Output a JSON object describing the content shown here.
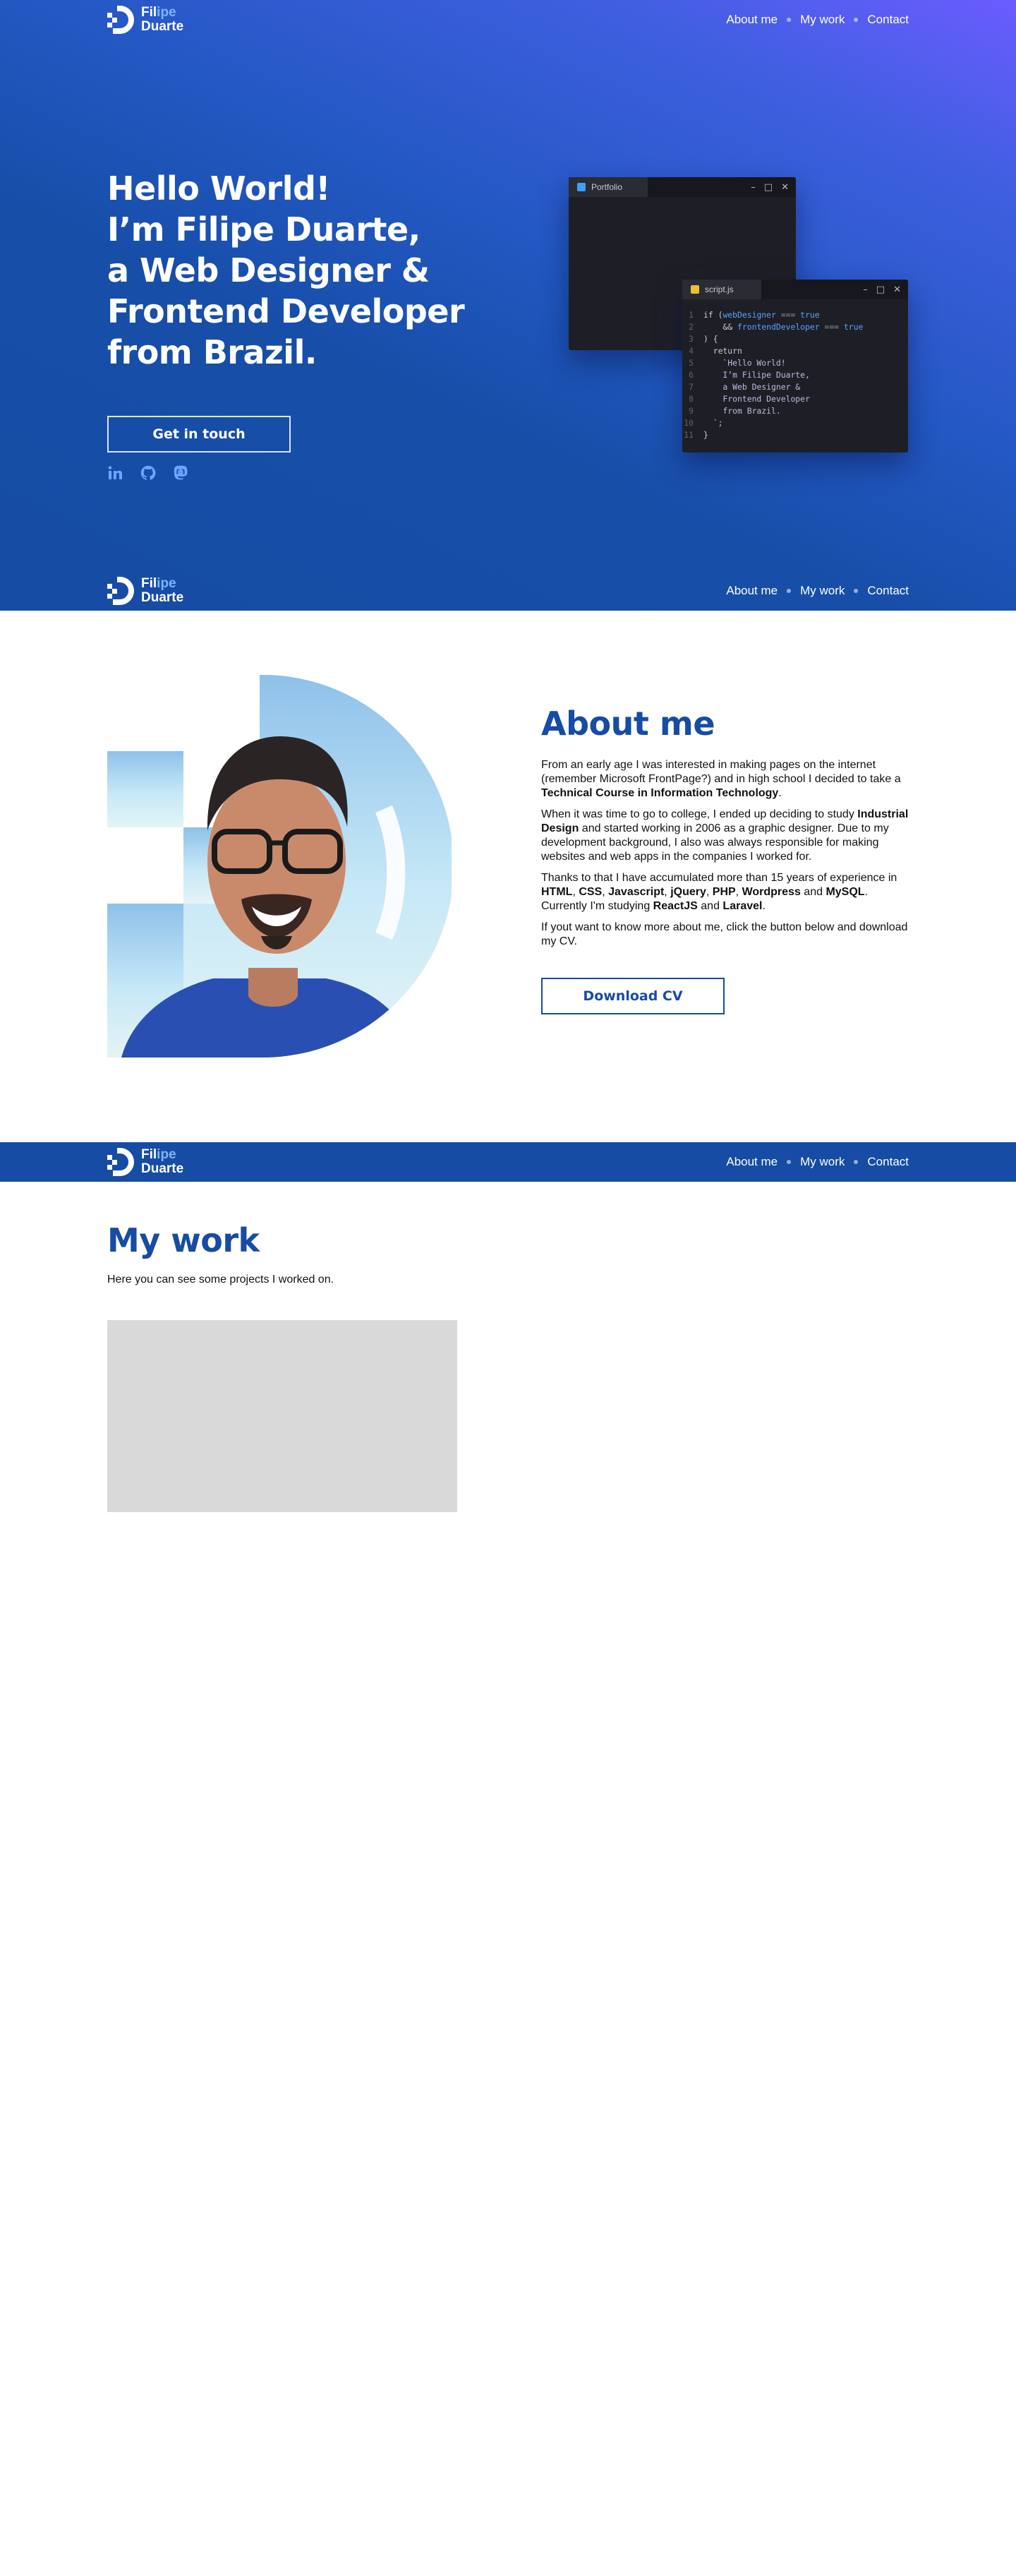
{
  "brand": {
    "first": "Fil",
    "first_highlight": "ipe",
    "last": "Duarte"
  },
  "nav": {
    "links": [
      "About me",
      "My work",
      "Contact"
    ]
  },
  "hero": {
    "lines": [
      "Hello World!",
      "I’m Filipe Duarte,",
      "a Web Designer &",
      "Frontend Developer",
      "from Brazil."
    ],
    "cta": "Get in touch",
    "socials": [
      "linkedin-icon",
      "github-icon",
      "mastodon-icon"
    ]
  },
  "editor": {
    "window_a": {
      "tab": "Portfolio",
      "controls": [
        "–",
        "□",
        "✕"
      ]
    },
    "window_b": {
      "tab": "script.js",
      "controls": [
        "–",
        "□",
        "✕"
      ],
      "code": [
        {
          "n": "1",
          "parts": [
            [
              "kw",
              "if ("
            ],
            [
              "var",
              "webDesigner"
            ],
            [
              "op",
              " === "
            ],
            [
              "var",
              "true"
            ]
          ]
        },
        {
          "n": "2",
          "parts": [
            [
              "kw",
              "    && "
            ],
            [
              "var",
              "frontendDeveloper"
            ],
            [
              "op",
              " === "
            ],
            [
              "var",
              "true"
            ]
          ]
        },
        {
          "n": "3",
          "parts": [
            [
              "kw",
              ") {"
            ]
          ]
        },
        {
          "n": "4",
          "parts": [
            [
              "kw",
              "  return"
            ]
          ]
        },
        {
          "n": "5",
          "parts": [
            [
              "str",
              "    `Hello World!"
            ]
          ]
        },
        {
          "n": "6",
          "parts": [
            [
              "str",
              "    I’m Filipe Duarte,"
            ]
          ]
        },
        {
          "n": "7",
          "parts": [
            [
              "str",
              "    a Web Designer &"
            ]
          ]
        },
        {
          "n": "8",
          "parts": [
            [
              "str",
              "    Frontend Developer"
            ]
          ]
        },
        {
          "n": "9",
          "parts": [
            [
              "str",
              "    from Brazil."
            ]
          ]
        },
        {
          "n": "10",
          "parts": [
            [
              "str",
              "  `;"
            ]
          ]
        },
        {
          "n": "11",
          "parts": [
            [
              "kw",
              "}"
            ]
          ]
        }
      ]
    }
  },
  "about": {
    "title": "About me",
    "paragraphs": [
      [
        [
          "t",
          "From an early age I was interested in making pages on the internet (remember Microsoft FrontPage?) and in high school I decided to take a "
        ],
        [
          "b",
          "Technical Course in Information Technology"
        ],
        [
          "t",
          "."
        ]
      ],
      [
        [
          "t",
          "When it was time to go to college, I ended up deciding to study "
        ],
        [
          "b",
          "Industrial Design"
        ],
        [
          "t",
          " and started working in 2006 as a graphic designer. Due to my development background, I also was always responsible for making websites and web apps in the companies I worked for."
        ]
      ],
      [
        [
          "t",
          "Thanks to that I have accumulated more than 15 years of experience in "
        ],
        [
          "b",
          "HTML"
        ],
        [
          "t",
          ", "
        ],
        [
          "b",
          "CSS"
        ],
        [
          "t",
          ", "
        ],
        [
          "b",
          "Javascript"
        ],
        [
          "t",
          ", "
        ],
        [
          "b",
          "jQuery"
        ],
        [
          "t",
          ", "
        ],
        [
          "b",
          "PHP"
        ],
        [
          "t",
          ", "
        ],
        [
          "b",
          "Wordpress"
        ],
        [
          "t",
          " and "
        ],
        [
          "b",
          "MySQL"
        ],
        [
          "t",
          ". Currently I'm studying "
        ],
        [
          "b",
          "ReactJS"
        ],
        [
          "t",
          " and "
        ],
        [
          "b",
          "Laravel"
        ],
        [
          "t",
          "."
        ]
      ],
      [
        [
          "t",
          "If yout want to know more about me, click the button below and download my CV."
        ]
      ]
    ],
    "cta": "Download CV"
  },
  "work": {
    "title": "My work",
    "subtitle": "Here you can see some projects I worked on."
  },
  "colors": {
    "primary": "#164ca3",
    "accent": "#6b5cff",
    "logo_highlight": "#7fb2ff",
    "editor_bg": "#1e1f26",
    "placeholder": "#d9d9d9"
  }
}
